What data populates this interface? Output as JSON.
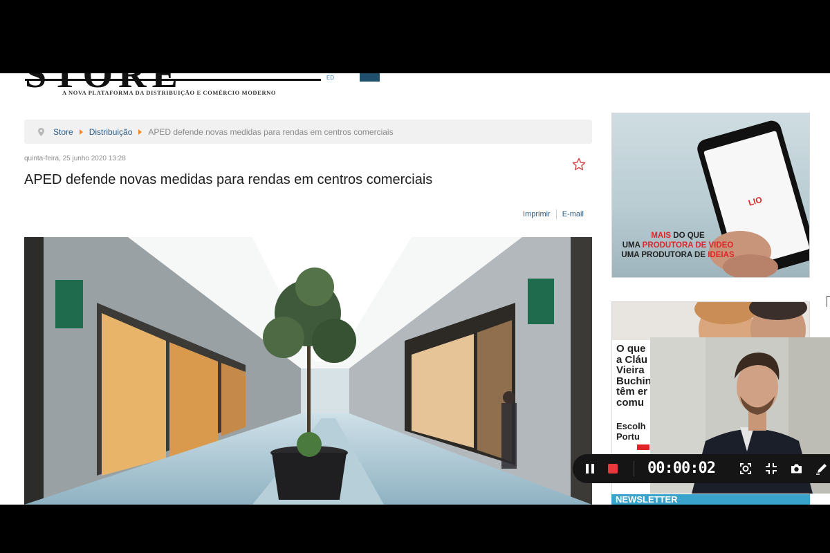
{
  "header": {
    "logo_text": "STORE",
    "edition": "ED",
    "tagline": "A NOVA PLATAFORMA DA DISTRIBUIÇÃO E COMÉRCIO MODERNO"
  },
  "breadcrumb": {
    "items": [
      "Store",
      "Distribuição",
      "APED defende novas medidas para rendas em centros comerciais"
    ]
  },
  "article": {
    "date": "quinta-feira, 25 junho 2020 13:28",
    "title": "APED defende novas medidas para rendas em centros comerciais",
    "actions": {
      "print": "Imprimir",
      "email": "E-mail"
    }
  },
  "ad1": {
    "line1_a": "MAIS",
    "line1_b": " DO QUE",
    "line2_a": "UMA ",
    "line2_b": "PRODUTORA DE VIDEO",
    "line3_a": "UMA PRODUTORA DE ",
    "line3_b": "IDEIAS",
    "phone_brand": "LIO"
  },
  "ad2": {
    "lines": [
      "O que",
      "a Cláu",
      "Vieira",
      "Buchin",
      "têm er",
      "comu"
    ],
    "sub_lines": [
      "Escolh",
      "Portu"
    ]
  },
  "newsletter": "NEWSLETTER",
  "recorder": {
    "timer": "00:00:02",
    "record_color": "#e8383c"
  },
  "colors": {
    "link": "#2b5c86",
    "accent_orange": "#f08a28",
    "newsletter_bg": "#3aa3cc"
  }
}
